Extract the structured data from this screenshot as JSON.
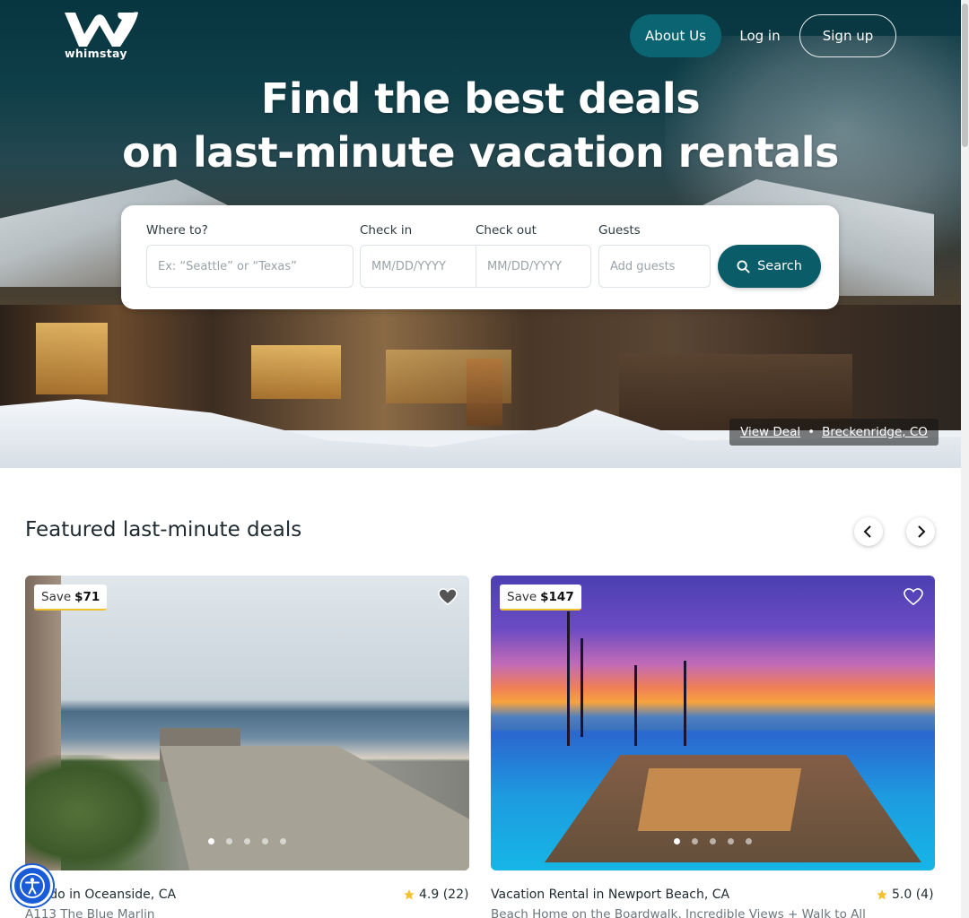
{
  "brand": {
    "name": "whimstay",
    "trademark": "™"
  },
  "nav": {
    "about": "About Us",
    "login": "Log in",
    "signup": "Sign up"
  },
  "hero": {
    "title_line1": "Find the best deals",
    "title_line2": "on last-minute vacation rentals",
    "deal_link": "View Deal",
    "deal_separator": "•",
    "deal_location": "Breckenridge, CO"
  },
  "search": {
    "where_label": "Where to?",
    "where_placeholder": "Ex: “Seattle” or “Texas”",
    "checkin_label": "Check in",
    "checkin_placeholder": "MM/DD/YYYY",
    "checkout_label": "Check out",
    "checkout_placeholder": "MM/DD/YYYY",
    "guests_label": "Guests",
    "guests_placeholder": "Add guests",
    "button": "Search"
  },
  "featured": {
    "title": "Featured last-minute deals",
    "cards": [
      {
        "save_prefix": "Save",
        "save_amount": "$71",
        "title": "Condo in Oceanside, CA",
        "rating": "4.9 (22)",
        "subtitle": "A113 The Blue Marlin",
        "image_dots": 5,
        "active_dot": 0
      },
      {
        "save_prefix": "Save",
        "save_amount": "$147",
        "title": "Vacation Rental in Newport Beach, CA",
        "rating": "5.0 (4)",
        "subtitle": "Beach Home on the Boardwalk, Incredible Views + Walk to All",
        "image_dots": 5,
        "active_dot": 0
      }
    ]
  },
  "colors": {
    "primary": "#0b5c69",
    "accent_star": "#f2c12e",
    "a11y": "#1a5bd8"
  }
}
